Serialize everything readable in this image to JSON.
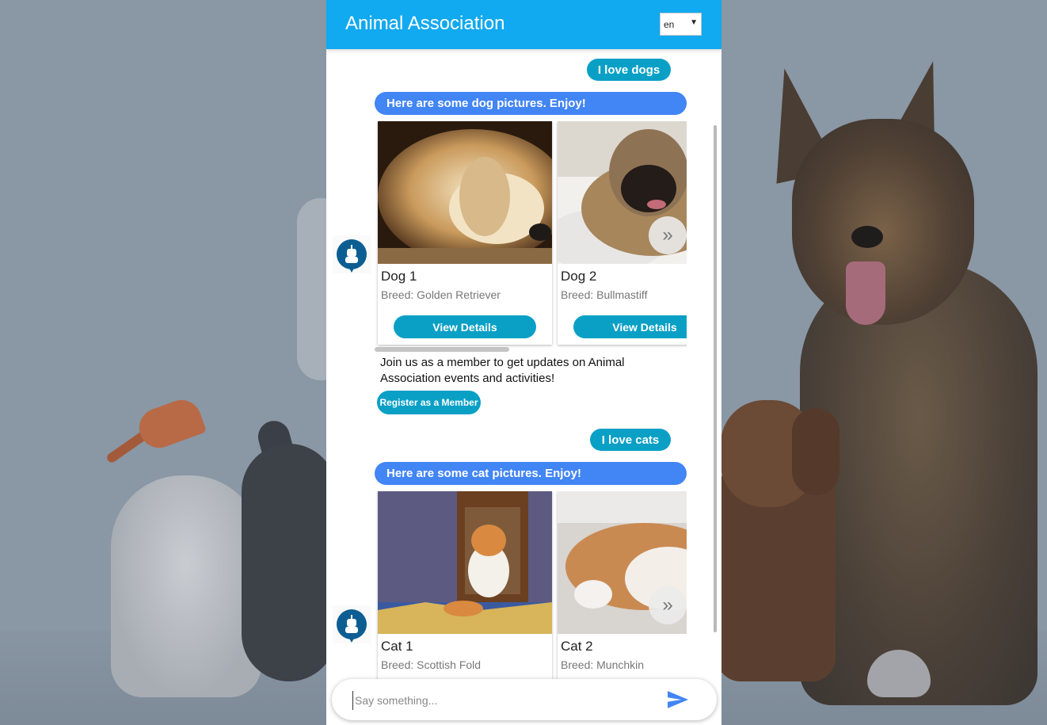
{
  "header": {
    "title": "Animal Association",
    "language": "en"
  },
  "messages": {
    "user_dogs": "I love dogs",
    "bot_dogs": "Here are some dog pictures. Enjoy!",
    "user_cats": "I love cats",
    "bot_cats": "Here are some cat pictures. Enjoy!"
  },
  "dog_cards": [
    {
      "title": "Dog 1",
      "subtitle": "Breed: Golden Retriever",
      "button": "View Details"
    },
    {
      "title": "Dog 2",
      "subtitle": "Breed: Bullmastiff",
      "button": "View Details"
    }
  ],
  "cat_cards": [
    {
      "title": "Cat 1",
      "subtitle": "Breed: Scottish Fold"
    },
    {
      "title": "Cat 2",
      "subtitle": "Breed: Munchkin"
    }
  ],
  "membership": {
    "text": "Join us as a member to get updates on Animal Association events and activities!",
    "button": "Register as a Member"
  },
  "carousel_next": "»",
  "input": {
    "placeholder": "Say something..."
  },
  "icons": {
    "avatar": "robot-icon",
    "send": "send-icon",
    "next": "chevron-double-right-icon"
  },
  "colors": {
    "header": "#11a9f0",
    "user_bubble": "#0aa0c6",
    "bot_bubble": "#4285f4",
    "avatar": "#0c5e92"
  }
}
